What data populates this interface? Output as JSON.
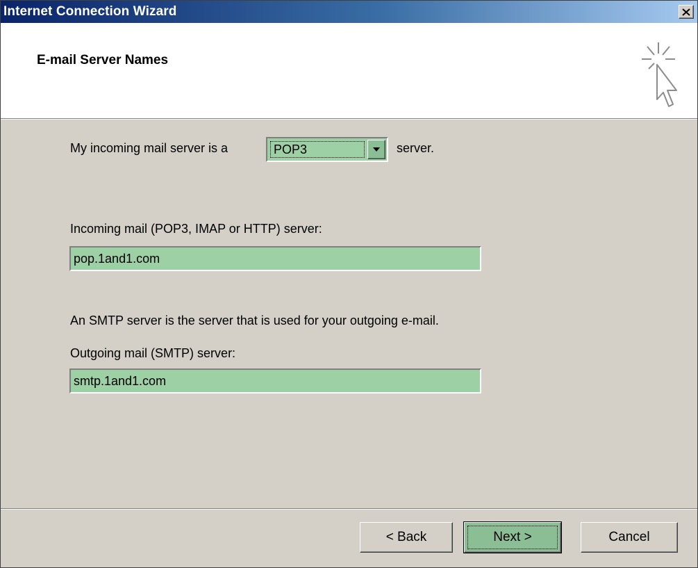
{
  "window": {
    "title": "Internet Connection Wizard",
    "close_icon": "close-x-icon"
  },
  "header": {
    "page_title": "E-mail Server Names",
    "icon": "wizard-cursor-sparkle-icon"
  },
  "server_type": {
    "label_prefix": "My incoming mail server is a",
    "selected": "POP3",
    "label_suffix": "server."
  },
  "incoming": {
    "label": "Incoming mail (POP3, IMAP or HTTP) server:",
    "value": "pop.1and1.com"
  },
  "outgoing": {
    "info": "An SMTP server is the server that is used for your outgoing e-mail.",
    "label": "Outgoing mail (SMTP) server:",
    "value": "smtp.1and1.com"
  },
  "buttons": {
    "back": "< Back",
    "next": "Next >",
    "cancel": "Cancel"
  },
  "colors": {
    "title_gradient_start": "#0a246a",
    "title_gradient_end": "#a6caf0",
    "dialog_face": "#d4d0c8",
    "field_highlight": "#9dd0a5"
  }
}
